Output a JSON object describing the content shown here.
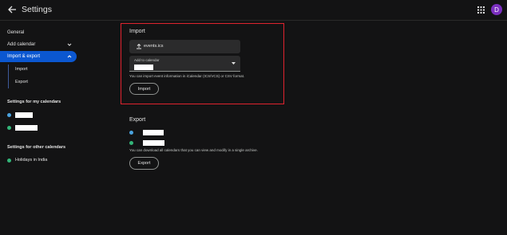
{
  "header": {
    "title": "Settings",
    "avatar_letter": "D",
    "avatar_color": "#7b2fbf"
  },
  "sidebar": {
    "general": "General",
    "add_calendar": "Add calendar",
    "import_export": "Import & export",
    "import": "Import",
    "export": "Export",
    "my_calendars_heading": "Settings for my calendars",
    "other_calendars_heading": "Settings for other calendars",
    "other_calendar_item": "Holidays in India",
    "my_calendar_colors": [
      "#4aa3df",
      "#33b679"
    ],
    "other_calendar_color": "#33b679"
  },
  "import_section": {
    "heading": "Import",
    "file_name": "events.ics",
    "select_label": "Add to calendar",
    "help_text": "You can import event information in iCalendar (ICS/VCS) or CSV format.",
    "button_label": "Import"
  },
  "export_section": {
    "heading": "Export",
    "calendar_colors": [
      "#4aa3df",
      "#33b679"
    ],
    "help_text": "You can download all calendars that you can view and modify in a single archive.",
    "button_label": "Export"
  },
  "colors": {
    "accent": "#0b57d0",
    "highlight_border": "#e0232e"
  }
}
